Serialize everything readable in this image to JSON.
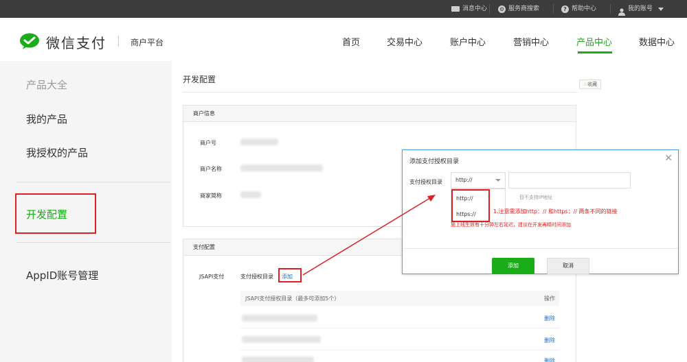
{
  "topbar": {
    "messages": "消息中心",
    "service_search": "服务商搜索",
    "help": "帮助中心",
    "account": "我的账号"
  },
  "header": {
    "logo_text": "微信支付",
    "platform": "商户平台",
    "nav": [
      "首页",
      "交易中心",
      "账户中心",
      "营销中心",
      "产品中心",
      "数据中心"
    ],
    "active_nav": "产品中心"
  },
  "sidebar": {
    "title": "产品大全",
    "items": [
      "我的产品",
      "我授权的产品",
      "开发配置",
      "AppID账号管理"
    ]
  },
  "main": {
    "page_title": "开发配置",
    "favorite": "收藏",
    "merchant_panel": {
      "header": "商户信息",
      "labels": [
        "商户号",
        "商户名称",
        "商家简称"
      ]
    },
    "payment_panel": {
      "header": "支付配置",
      "jsapi_label": "JSAPI支付",
      "dir_label": "支付授权目录",
      "add_link": "添加",
      "table_header": "JSAPI支付授权目录（最多可添加5个）",
      "ops_header": "操作",
      "delete_label": "删除"
    }
  },
  "dialog": {
    "title": "添加支付授权目录",
    "field_label": "支付授权目录",
    "select_value": "http://",
    "options": [
      "http://",
      "https://"
    ],
    "hint": "目不支持IP地址",
    "annotation": "1.注意需添加http：// 和https：// 两条不同的链接",
    "warning": "施上线生效有十分钟左右延迟，建议在开发再精时间添加",
    "confirm": "添加",
    "cancel": "取消"
  },
  "colors": {
    "brand_green": "#1aad19",
    "annotation_red": "#e02020",
    "link_blue": "#1a6fd1",
    "topbar_bg": "#3c3c3c"
  }
}
